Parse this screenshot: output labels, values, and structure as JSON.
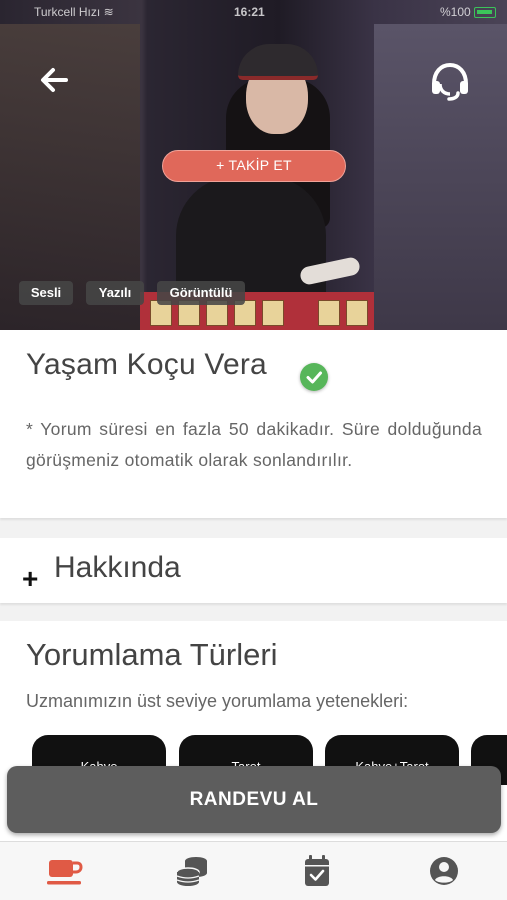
{
  "status_bar": {
    "carrier": "Turkcell Hızı ≋",
    "time": "16:21",
    "battery": "%100"
  },
  "hero": {
    "follow_label": "+ TAKİP ET",
    "chips": [
      "Sesli",
      "Yazılı",
      "Görüntülü"
    ]
  },
  "profile": {
    "name": "Yaşam Koçu Vera",
    "note": "* Yorum süresi en fazla 50 dakikadır. Süre dolduğunda görüşmeniz otomatik olarak sonlandırılır."
  },
  "about": {
    "toggle": "+",
    "title": "Hakkında"
  },
  "services": {
    "title": "Yorumlama Türleri",
    "subtitle": "Uzmanımızın üst seviye yorumlama yetenekleri:",
    "items": [
      "Kahve",
      "Tarot",
      "Kahve+Tarot",
      ""
    ]
  },
  "cta": {
    "label": "RANDEVU AL"
  },
  "tabbar": {
    "items": [
      "coffee-cup-icon",
      "coins-icon",
      "calendar-check-icon",
      "account-icon"
    ],
    "active_index": 0
  },
  "colors": {
    "accent": "#e0685a",
    "verified": "#57b65a",
    "cta": "#5d5d5d",
    "tab_active": "#e05a45",
    "tab_inactive": "#555555"
  }
}
